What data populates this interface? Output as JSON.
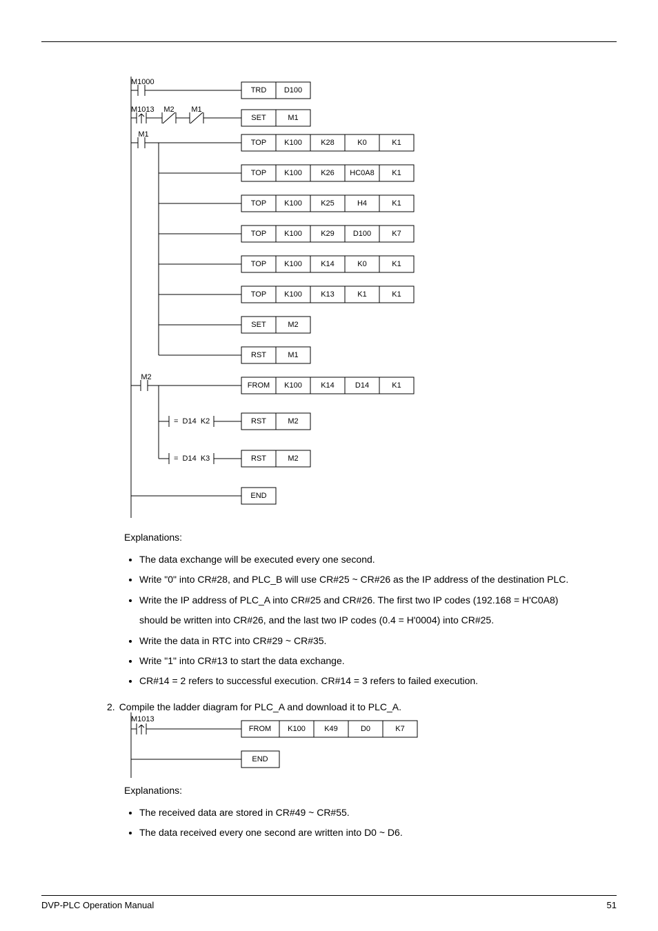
{
  "ladder1": {
    "rung1": {
      "contact": "M1000",
      "inst": [
        "TRD",
        "D100"
      ]
    },
    "rung2": {
      "c1": "M1013",
      "c2": "M2",
      "c3": "M1",
      "inst": [
        "SET",
        "M1"
      ]
    },
    "rung3": {
      "contact": "M1",
      "rows": [
        [
          "TOP",
          "K100",
          "K28",
          "K0",
          "K1"
        ],
        [
          "TOP",
          "K100",
          "K26",
          "HC0A8",
          "K1"
        ],
        [
          "TOP",
          "K100",
          "K25",
          "H4",
          "K1"
        ],
        [
          "TOP",
          "K100",
          "K29",
          "D100",
          "K7"
        ],
        [
          "TOP",
          "K100",
          "K14",
          "K0",
          "K1"
        ],
        [
          "TOP",
          "K100",
          "K13",
          "K1",
          "K1"
        ],
        [
          "SET",
          "M2"
        ],
        [
          "RST",
          "M1"
        ]
      ]
    },
    "rung4": {
      "contact": "M2",
      "row1": [
        "FROM",
        "K100",
        "K14",
        "D14",
        "K1"
      ],
      "cmp1": "=  D14  K2",
      "inst2": [
        "RST",
        "M2"
      ],
      "cmp2": "=  D14  K3",
      "inst3": [
        "RST",
        "M2"
      ]
    },
    "end": "END"
  },
  "explanations1": {
    "heading": "Explanations:",
    "items": [
      "The data exchange will be executed every one second.",
      "Write \"0\" into CR#28, and PLC_B will use CR#25 ~ CR#26 as the IP address of the destination PLC.",
      "Write the IP address of PLC_A into CR#25 and CR#26. The first two IP codes (192.168 = H'C0A8) should be written into CR#26, and the last two IP codes (0.4 = H'0004) into CR#25.",
      "Write the data in RTC into CR#29 ~ CR#35.",
      "Write \"1\" into CR#13 to start the data exchange.",
      "CR#14 = 2 refers to successful execution. CR#14 = 3 refers to failed execution."
    ]
  },
  "step2": {
    "num": "2.",
    "text": "Compile the ladder diagram for PLC_A and download it to PLC_A."
  },
  "ladder2": {
    "rung1": {
      "contact": "M1013",
      "inst": [
        "FROM",
        "K100",
        "K49",
        "D0",
        "K7"
      ]
    },
    "end": "END"
  },
  "explanations2": {
    "heading": "Explanations:",
    "items": [
      "The received data are stored in CR#49 ~ CR#55.",
      "The data received every one second are written into D0 ~ D6."
    ]
  },
  "footer": {
    "left": "DVP-PLC Operation Manual",
    "right": "51"
  }
}
